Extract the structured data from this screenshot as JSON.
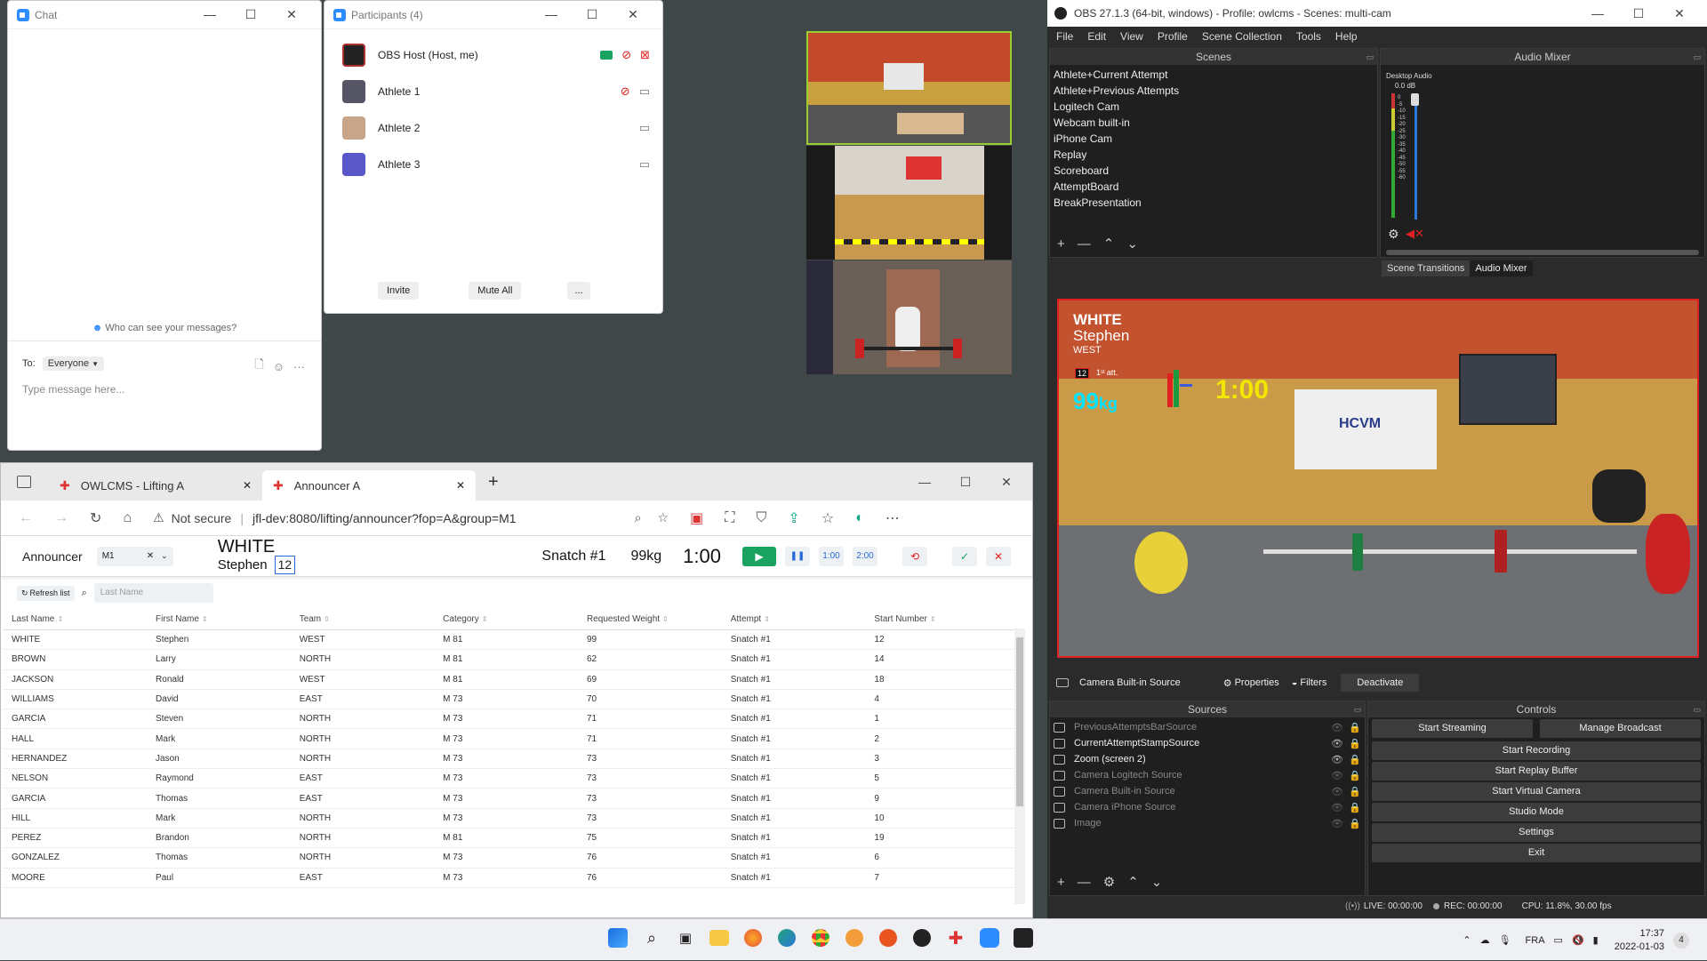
{
  "chat": {
    "title": "Chat",
    "privacy_note": "Who can see your messages?",
    "to_label": "To:",
    "to_value": "Everyone",
    "placeholder": "Type message here..."
  },
  "participants": {
    "title": "Participants (4)",
    "list": [
      {
        "name": "OBS Host (Host, me)"
      },
      {
        "name": "Athlete 1"
      },
      {
        "name": "Athlete 2"
      },
      {
        "name": "Athlete 3"
      }
    ],
    "invite": "Invite",
    "mute_all": "Mute All",
    "more": "..."
  },
  "browser": {
    "tabs": [
      {
        "label": "OWLCMS - Lifting A"
      },
      {
        "label": "Announcer A"
      }
    ],
    "not_secure": "Not secure",
    "url": "jfl-dev:8080/lifting/announcer?fop=A&group=M1"
  },
  "announcer": {
    "label": "Announcer",
    "group": "M1",
    "last_name": "WHITE",
    "first_name": "Stephen",
    "start_number": "12",
    "attempt": "Snatch #1",
    "weight": "99kg",
    "clock": "1:00",
    "btn_1min": "1:00",
    "btn_2min": "2:00",
    "refresh": "Refresh list",
    "search_placeholder": "Last Name",
    "columns": [
      "Last Name",
      "First Name",
      "Team",
      "Category",
      "Requested Weight",
      "Attempt",
      "Start Number"
    ],
    "rows": [
      [
        "WHITE",
        "Stephen",
        "WEST",
        "M 81",
        "99",
        "Snatch #1",
        "12"
      ],
      [
        "BROWN",
        "Larry",
        "NORTH",
        "M 81",
        "62",
        "Snatch #1",
        "14"
      ],
      [
        "JACKSON",
        "Ronald",
        "WEST",
        "M 81",
        "69",
        "Snatch #1",
        "18"
      ],
      [
        "WILLIAMS",
        "David",
        "EAST",
        "M 73",
        "70",
        "Snatch #1",
        "4"
      ],
      [
        "GARCIA",
        "Steven",
        "NORTH",
        "M 73",
        "71",
        "Snatch #1",
        "1"
      ],
      [
        "HALL",
        "Mark",
        "NORTH",
        "M 73",
        "71",
        "Snatch #1",
        "2"
      ],
      [
        "HERNANDEZ",
        "Jason",
        "NORTH",
        "M 73",
        "73",
        "Snatch #1",
        "3"
      ],
      [
        "NELSON",
        "Raymond",
        "EAST",
        "M 73",
        "73",
        "Snatch #1",
        "5"
      ],
      [
        "GARCIA",
        "Thomas",
        "EAST",
        "M 73",
        "73",
        "Snatch #1",
        "9"
      ],
      [
        "HILL",
        "Mark",
        "NORTH",
        "M 73",
        "73",
        "Snatch #1",
        "10"
      ],
      [
        "PEREZ",
        "Brandon",
        "NORTH",
        "M 81",
        "75",
        "Snatch #1",
        "19"
      ],
      [
        "GONZALEZ",
        "Thomas",
        "NORTH",
        "M 73",
        "76",
        "Snatch #1",
        "6"
      ],
      [
        "MOORE",
        "Paul",
        "EAST",
        "M 73",
        "76",
        "Snatch #1",
        "7"
      ]
    ]
  },
  "obs": {
    "title": "OBS 27.1.3 (64-bit, windows) - Profile: owlcms - Scenes: multi-cam",
    "menu": [
      "File",
      "Edit",
      "View",
      "Profile",
      "Scene Collection",
      "Tools",
      "Help"
    ],
    "scenes_header": "Scenes",
    "scenes": [
      "Athlete+Current Attempt",
      "Athlete+Previous Attempts",
      "Logitech Cam",
      "Webcam built-in",
      "iPhone Cam",
      "Replay",
      "Scoreboard",
      "AttemptBoard",
      "BreakPresentation"
    ],
    "mixer_header": "Audio Mixer",
    "desktop_audio": "Desktop Audio",
    "db": "0.0 dB",
    "meter_ticks": [
      "0",
      "-5",
      "-10",
      "-15",
      "-20",
      "-25",
      "-30",
      "-35",
      "-40",
      "-45",
      "-50",
      "-55",
      "-60"
    ],
    "tab_transitions": "Scene Transitions",
    "tab_mixer": "Audio Mixer",
    "preview": {
      "last": "WHITE",
      "first": "Stephen",
      "team": "WEST",
      "start": "12",
      "att_num": "1",
      "att_sup": "st",
      "att_word": "att.",
      "weight": "99",
      "unit": "kg",
      "clock": "1:00",
      "banner": "HCVM"
    },
    "source_bar": {
      "name": "Camera Built-in Source",
      "properties": "Properties",
      "filters": "Filters",
      "deactivate": "Deactivate"
    },
    "sources_header": "Sources",
    "sources": [
      {
        "name": "PreviousAttemptsBarSource",
        "visible": false
      },
      {
        "name": "CurrentAttemptStampSource",
        "visible": true
      },
      {
        "name": "Zoom (screen 2)",
        "visible": true
      },
      {
        "name": "Camera Logitech Source",
        "visible": false
      },
      {
        "name": "Camera Built-in Source",
        "visible": false
      },
      {
        "name": "Camera iPhone Source",
        "visible": false
      },
      {
        "name": "Image",
        "visible": false
      }
    ],
    "controls_header": "Controls",
    "start_streaming": "Start Streaming",
    "manage_broadcast": "Manage Broadcast",
    "controls": [
      "Start Recording",
      "Start Replay Buffer",
      "Start Virtual Camera",
      "Studio Mode",
      "Settings",
      "Exit"
    ],
    "status_live": "LIVE: 00:00:00",
    "status_rec": "REC: 00:00:00",
    "status_cpu": "CPU: 11.8%, 30.00 fps"
  },
  "taskbar": {
    "lang": "FRA",
    "time": "17:37",
    "date": "2022-01-03",
    "notif": "4"
  },
  "colors": {
    "obs_bg": "#2b2b2b",
    "accent_red": "#e02020",
    "zoom_blue": "#2d8cff",
    "green": "#1aa260"
  }
}
